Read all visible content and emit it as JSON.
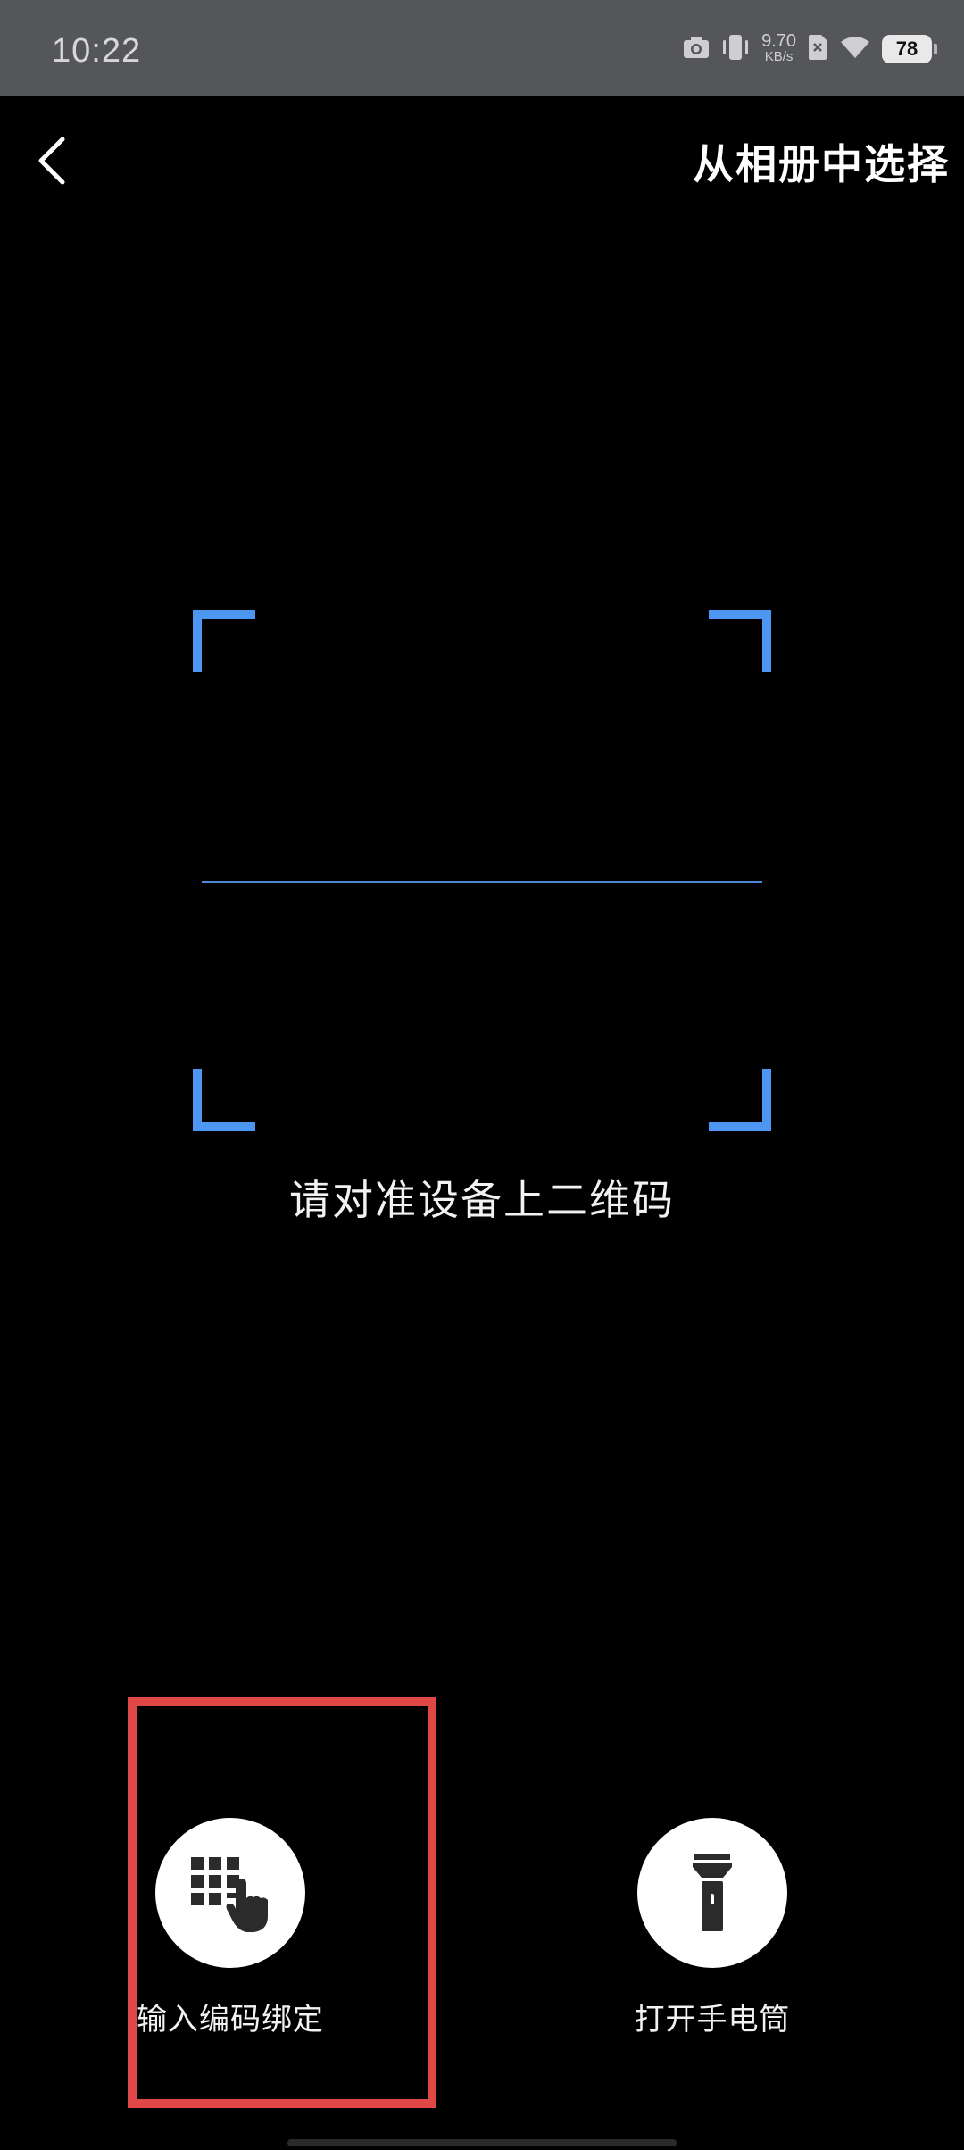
{
  "status_bar": {
    "time": "10:22",
    "net_speed_value": "9.70",
    "net_speed_unit": "KB/s",
    "battery": "78",
    "icons": [
      "camera-icon",
      "vibrate-icon",
      "sim-off-icon",
      "wifi-icon",
      "battery-icon"
    ]
  },
  "header": {
    "back_icon": "chevron-left-icon",
    "album_label": "从相册中选择"
  },
  "scanner": {
    "hint": "请对准设备上二维码",
    "accent_color": "#4d96f2"
  },
  "actions": [
    {
      "label": "输入编码绑定",
      "icon": "keypad-touch-icon"
    },
    {
      "label": "打开手电筒",
      "icon": "flashlight-icon"
    }
  ],
  "highlight_color": "#e04848"
}
